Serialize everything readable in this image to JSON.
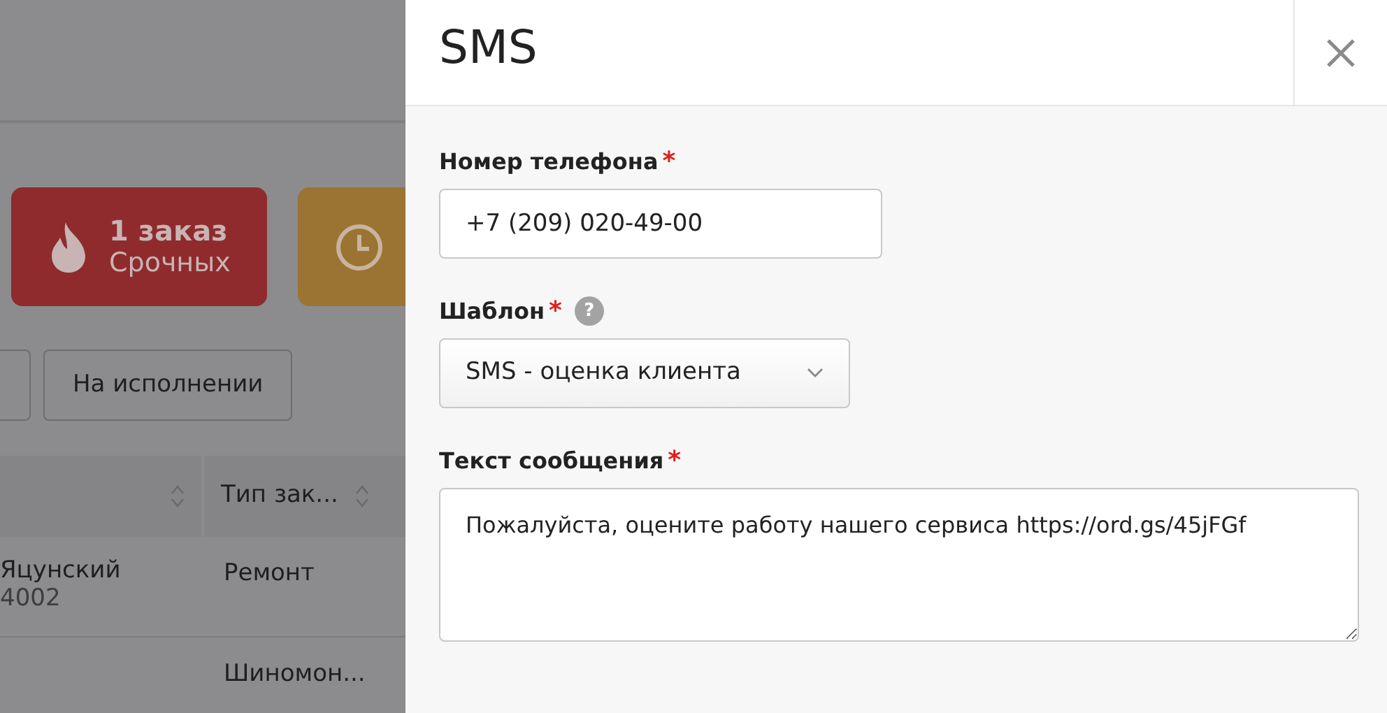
{
  "background": {
    "cards": [
      {
        "kind": "urgent",
        "title": "1 заказ",
        "subtitle": "Срочных",
        "color": "#8f2b2d"
      },
      {
        "kind": "overdue",
        "color": "#9b7434"
      }
    ],
    "filter_buttons": [
      {
        "kind": "cut"
      },
      {
        "kind": "full",
        "label": "На исполнении"
      }
    ],
    "table": {
      "columns": [
        {
          "kind": "cut"
        },
        {
          "kind": "full",
          "label": "Тип зак..."
        }
      ],
      "rows": [
        {
          "client": "Яцунский",
          "number": "4002",
          "type": "Ремонт"
        },
        {
          "type": "Шиномон..."
        }
      ]
    }
  },
  "dialog": {
    "title": "SMS",
    "fields": [
      {
        "kind": "input",
        "label": "Номер телефона",
        "required_mark": "*",
        "value": "+7 (209) 020-49-00"
      },
      {
        "kind": "select",
        "label": "Шаблон",
        "required_mark": "*",
        "help": "?",
        "value": "SMS - оценка клиента"
      },
      {
        "kind": "textarea",
        "label": "Текст сообщения",
        "required_mark": "*",
        "value": "Пожалуйста, оцените работу нашего сервиса https://ord.gs/45jFGf"
      }
    ]
  }
}
